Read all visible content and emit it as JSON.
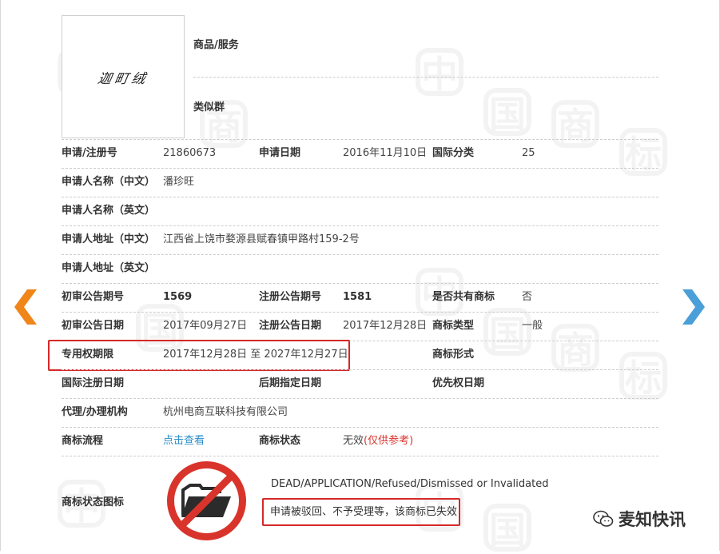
{
  "logo": {
    "text": "迦町绒"
  },
  "header_rows": {
    "goods_label": "商品/服务",
    "group_label": "类似群"
  },
  "rows": {
    "reg_no_label": "申请/注册号",
    "reg_no": "21860673",
    "app_date_label": "申请日期",
    "app_date": "2016年11月10日",
    "intl_class_label": "国际分类",
    "intl_class": "25",
    "applicant_cn_label": "申请人名称（中文）",
    "applicant_cn": "潘珍旺",
    "applicant_en_label": "申请人名称（英文）",
    "address_cn_label": "申请人地址（中文）",
    "address_cn": "江西省上饶市婺源县赋春镇甲路村159-2号",
    "address_en_label": "申请人地址（英文）",
    "prelim_no_label": "初审公告期号",
    "prelim_no": "1569",
    "reg_pub_no_label": "注册公告期号",
    "reg_pub_no": "1581",
    "shared_label": "是否共有商标",
    "shared": "否",
    "prelim_date_label": "初审公告日期",
    "prelim_date": "2017年09月27日",
    "reg_pub_date_label": "注册公告日期",
    "reg_pub_date": "2017年12月28日",
    "tm_type_label": "商标类型",
    "tm_type": "一般",
    "exclusive_label": "专用权期限",
    "exclusive": "2017年12月28日 至 2027年12月27日",
    "tm_form_label": "商标形式",
    "intl_reg_date_label": "国际注册日期",
    "later_date_label": "后期指定日期",
    "priority_date_label": "优先权日期",
    "agent_label": "代理/办理机构",
    "agent": "杭州电商互联科技有限公司",
    "process_label": "商标流程",
    "process_link": "点击查看",
    "status_label": "商标状态",
    "status": "无效",
    "status_note": "(仅供参考)",
    "status_icon_label": "商标状态图标",
    "status_en": "DEAD/APPLICATION/Refused/Dismissed or Invalidated",
    "status_cn": "申请被驳回、不予受理等，该商标已失效"
  },
  "watermark": {
    "chars": [
      "中",
      "国",
      "商",
      "标"
    ],
    "brand": "麦知快讯"
  },
  "icons": {
    "prev": "chevron-left-orange-icon",
    "next": "chevron-right-blue-icon",
    "status": "folder-prohibited-icon",
    "wechat": "wechat-icon"
  },
  "colors": {
    "accent_red": "#d52828",
    "link": "#2a8ec9",
    "prev_arrow": "#f08519",
    "next_arrow": "#4a9fd8"
  }
}
